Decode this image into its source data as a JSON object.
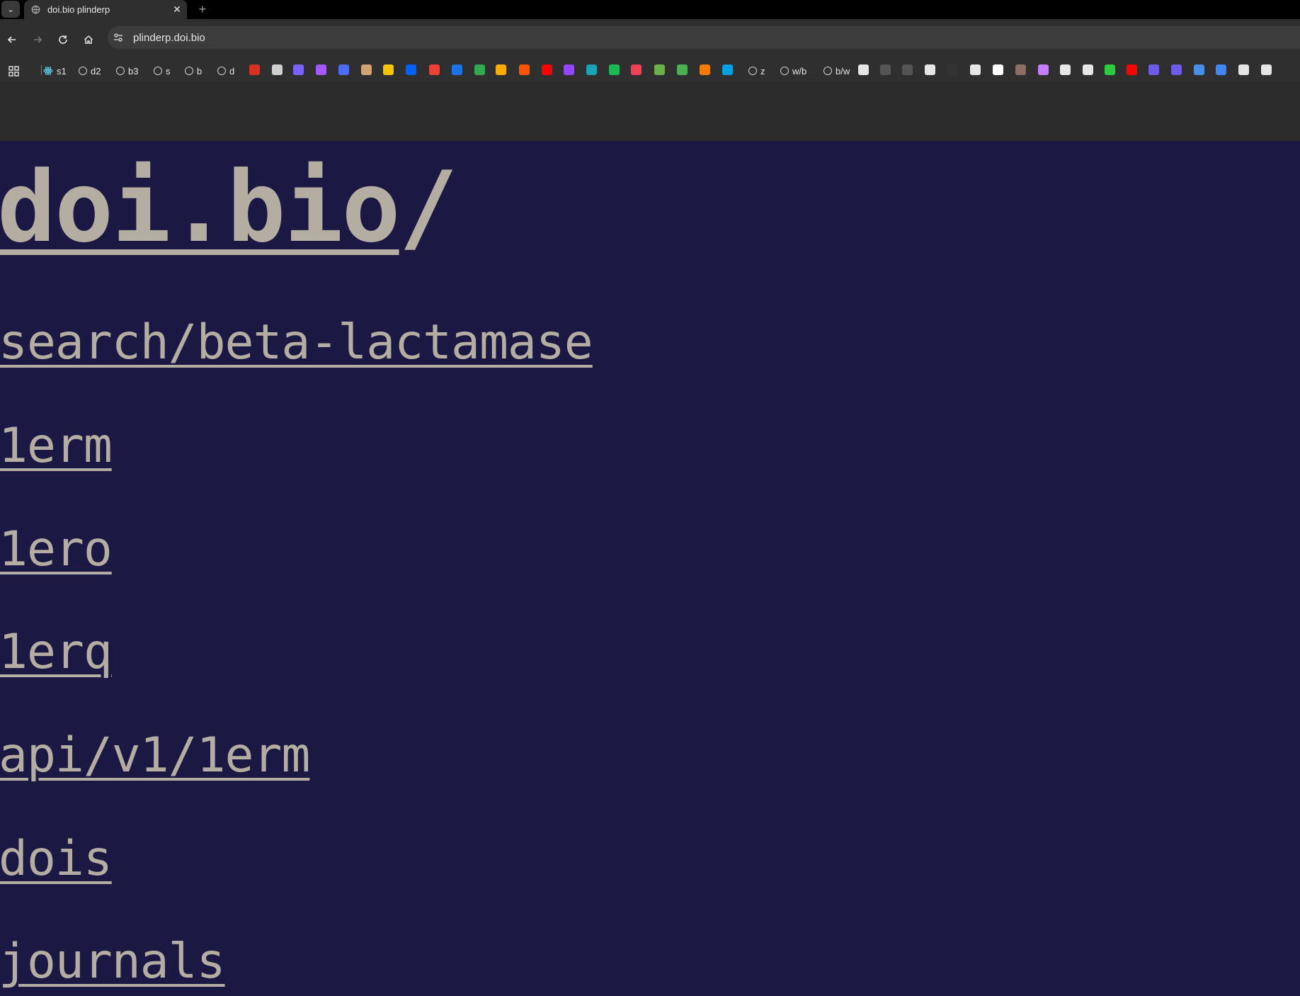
{
  "browser": {
    "tab": {
      "title": "doi.bio plinderp",
      "close": "✕",
      "new_tab": "+",
      "list": "⌄"
    },
    "address": {
      "url": "plinderp.doi.bio"
    },
    "bookmarks": {
      "labeled": [
        {
          "label": "s1"
        },
        {
          "label": "d2"
        },
        {
          "label": "b3"
        },
        {
          "label": "s"
        },
        {
          "label": "b"
        },
        {
          "label": "d"
        },
        {
          "label": "z"
        },
        {
          "label": "w/b"
        },
        {
          "label": "b/w"
        }
      ],
      "icons": [
        {
          "name": "bookmark-icon-red",
          "color": "#d93025"
        },
        {
          "name": "bookmark-icon-globe",
          "color": "#cfcfcf"
        },
        {
          "name": "bookmark-icon-purple",
          "color": "#7b61ff"
        },
        {
          "name": "bookmark-icon-figma",
          "color": "#a259ff"
        },
        {
          "name": "bookmark-icon-slack",
          "color": "#4a6cf7"
        },
        {
          "name": "bookmark-icon-anthropic",
          "color": "#d4a373"
        },
        {
          "name": "bookmark-icon-yellow",
          "color": "#f5c400"
        },
        {
          "name": "bookmark-icon-dropbox",
          "color": "#0061ff"
        },
        {
          "name": "bookmark-icon-gmail",
          "color": "#ea4335"
        },
        {
          "name": "bookmark-icon-calendar",
          "color": "#1a73e8"
        },
        {
          "name": "bookmark-icon-drive",
          "color": "#34a853"
        },
        {
          "name": "bookmark-icon-sun",
          "color": "#f9ab00"
        },
        {
          "name": "bookmark-icon-soundcloud",
          "color": "#ff5500"
        },
        {
          "name": "bookmark-icon-youtube",
          "color": "#ff0000"
        },
        {
          "name": "bookmark-icon-twitch",
          "color": "#9146ff"
        },
        {
          "name": "bookmark-icon-teal",
          "color": "#1aa3b5"
        },
        {
          "name": "bookmark-icon-spotify",
          "color": "#1db954"
        },
        {
          "name": "bookmark-icon-pocket",
          "color": "#ef4056"
        },
        {
          "name": "bookmark-icon-green",
          "color": "#6ab04c"
        },
        {
          "name": "bookmark-icon-colorful",
          "color": "#4caf50"
        },
        {
          "name": "bookmark-icon-orange-box",
          "color": "#f57c00"
        },
        {
          "name": "bookmark-icon-salesforce",
          "color": "#00a1e0"
        },
        {
          "name": "bookmark-icon-openai",
          "color": "#e6e6e6"
        },
        {
          "name": "bookmark-icon-openai-dark",
          "color": "#555555"
        },
        {
          "name": "bookmark-icon-openai-dark2",
          "color": "#555555"
        },
        {
          "name": "bookmark-icon-github",
          "color": "#e6e6e6"
        },
        {
          "name": "bookmark-icon-dark",
          "color": "#333333"
        },
        {
          "name": "bookmark-icon-doc",
          "color": "#e6e6e6"
        },
        {
          "name": "bookmark-icon-medium",
          "color": "#ffffff"
        },
        {
          "name": "bookmark-icon-cat",
          "color": "#8d6e63"
        },
        {
          "name": "bookmark-icon-pen",
          "color": "#c77dff"
        },
        {
          "name": "bookmark-icon-doc2",
          "color": "#e6e6e6"
        },
        {
          "name": "bookmark-icon-smile",
          "color": "#e6e6e6"
        },
        {
          "name": "bookmark-icon-green-r",
          "color": "#2ecc40"
        },
        {
          "name": "bookmark-icon-youtube2",
          "color": "#ff0000"
        },
        {
          "name": "bookmark-icon-c1",
          "color": "#6c5ce7"
        },
        {
          "name": "bookmark-icon-c2",
          "color": "#6c5ce7"
        },
        {
          "name": "bookmark-icon-blue-screen",
          "color": "#4a8fe7"
        },
        {
          "name": "bookmark-icon-cloud",
          "color": "#4285f4"
        },
        {
          "name": "bookmark-icon-doc3",
          "color": "#e6e6e6"
        },
        {
          "name": "bookmark-icon-doc4",
          "color": "#e6e6e6"
        }
      ]
    }
  },
  "page": {
    "title": "doi.bio",
    "title_suffix": "/",
    "links": [
      {
        "text": "search/beta-lactamase"
      },
      {
        "text": "1erm"
      },
      {
        "text": "1ero"
      },
      {
        "text": "1erq"
      },
      {
        "text": "api/v1/1erm"
      },
      {
        "text": "dois"
      },
      {
        "text": "journals"
      }
    ]
  },
  "colors": {
    "page_bg": "#1b1944",
    "link_text": "#b4aea2",
    "chrome_bg": "#2f2f2f"
  }
}
